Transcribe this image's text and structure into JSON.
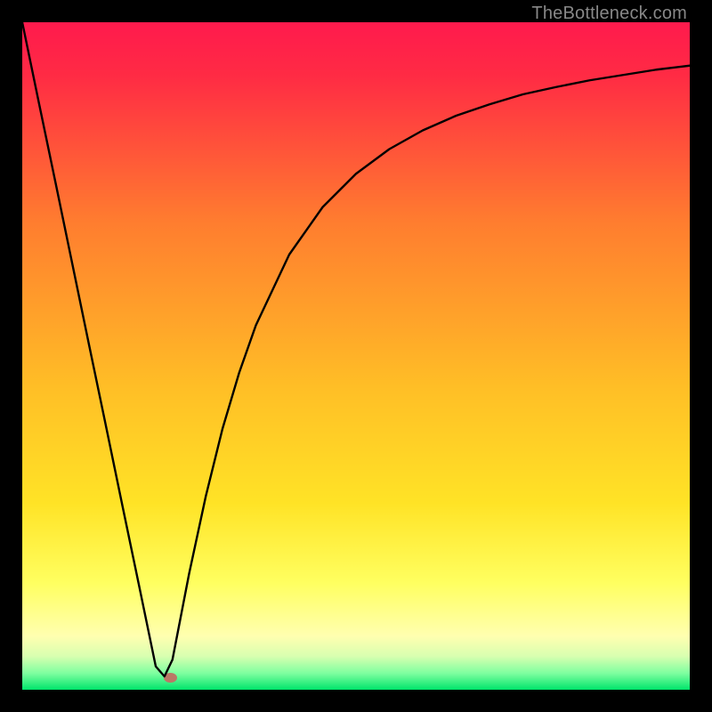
{
  "watermark": "TheBottleneck.com",
  "colors": {
    "top": "#ff1a4d",
    "mid": "#ffa226",
    "low": "#ffe326",
    "pale": "#ffff9a",
    "green": "#00e56b",
    "border": "#000000"
  },
  "chart_data": {
    "type": "line",
    "title": "",
    "xlabel": "",
    "ylabel": "",
    "xlim": [
      0,
      1
    ],
    "ylim": [
      0,
      1
    ],
    "x": [
      0.0,
      0.025,
      0.05,
      0.075,
      0.1,
      0.125,
      0.15,
      0.175,
      0.2,
      0.213,
      0.225,
      0.25,
      0.275,
      0.3,
      0.325,
      0.35,
      0.4,
      0.45,
      0.5,
      0.55,
      0.6,
      0.65,
      0.7,
      0.75,
      0.8,
      0.85,
      0.9,
      0.95,
      1.0
    ],
    "y": [
      1.0,
      0.879,
      0.759,
      0.638,
      0.517,
      0.397,
      0.276,
      0.156,
      0.035,
      0.02,
      0.045,
      0.174,
      0.29,
      0.391,
      0.475,
      0.546,
      0.652,
      0.723,
      0.773,
      0.81,
      0.838,
      0.86,
      0.877,
      0.892,
      0.903,
      0.913,
      0.921,
      0.929,
      0.935
    ],
    "marker": {
      "x": 0.222,
      "y": 0.018
    }
  }
}
